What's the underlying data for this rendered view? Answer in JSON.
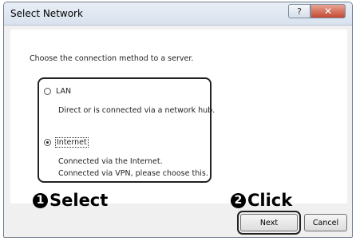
{
  "window": {
    "title": "Select Network",
    "help_icon": "?",
    "close_icon": "✕"
  },
  "instruction": "Choose the connection method to a server.",
  "options": {
    "lan": {
      "label": "LAN",
      "selected": false,
      "description": "Direct or is connected via a network hub."
    },
    "internet": {
      "label": "Internet",
      "selected": true,
      "description_line1": "Connected via the Internet.",
      "description_line2": "Connected via VPN, please choose this."
    }
  },
  "annotations": {
    "step1_number": "1",
    "step1_text": "Select",
    "step2_number": "2",
    "step2_text": "Click"
  },
  "buttons": {
    "next": "Next",
    "cancel": "Cancel"
  }
}
